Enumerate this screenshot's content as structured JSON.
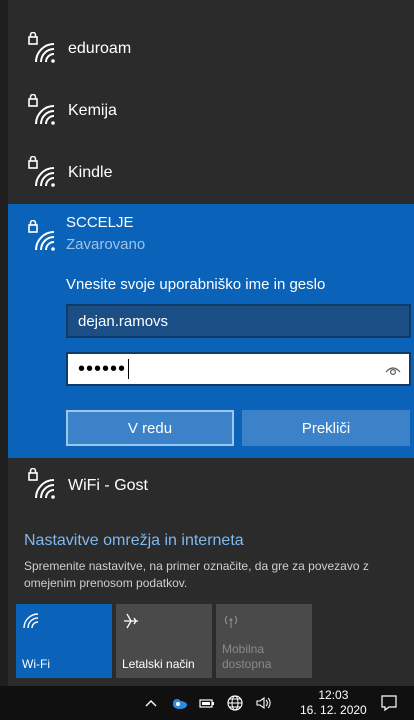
{
  "networks": [
    {
      "name": "eduroam"
    },
    {
      "name": "Kemija"
    },
    {
      "name": "Kindle"
    }
  ],
  "selected_network": {
    "name": "SCCELJE",
    "status": "Zavarovano",
    "prompt": "Vnesite svoje uporabniško ime in geslo",
    "username_value": "dejan.ramovs",
    "password_mask": "••••••",
    "ok_label": "V redu",
    "cancel_label": "Prekliči"
  },
  "guest_network": {
    "name": "WiFi - Gost"
  },
  "settings": {
    "title": "Nastavitve omrežja in interneta",
    "description": "Spremenite nastavitve, na primer označite, da gre za povezavo z omejenim prenosom podatkov."
  },
  "quick_actions": [
    {
      "label": "Wi-Fi",
      "icon": "wifi-icon",
      "state": "on"
    },
    {
      "label": "Letalski način",
      "icon": "airplane-icon",
      "state": "off"
    },
    {
      "label_line1": "Mobilna",
      "label_line2": "dostopna",
      "icon": "hotspot-icon",
      "state": "disabled"
    }
  ],
  "taskbar": {
    "time": "12:03",
    "date": "16. 12. 2020"
  },
  "colors": {
    "accent": "#0a63b8",
    "link": "#7fb9f0",
    "panel_bg": "#2b2b2b"
  }
}
